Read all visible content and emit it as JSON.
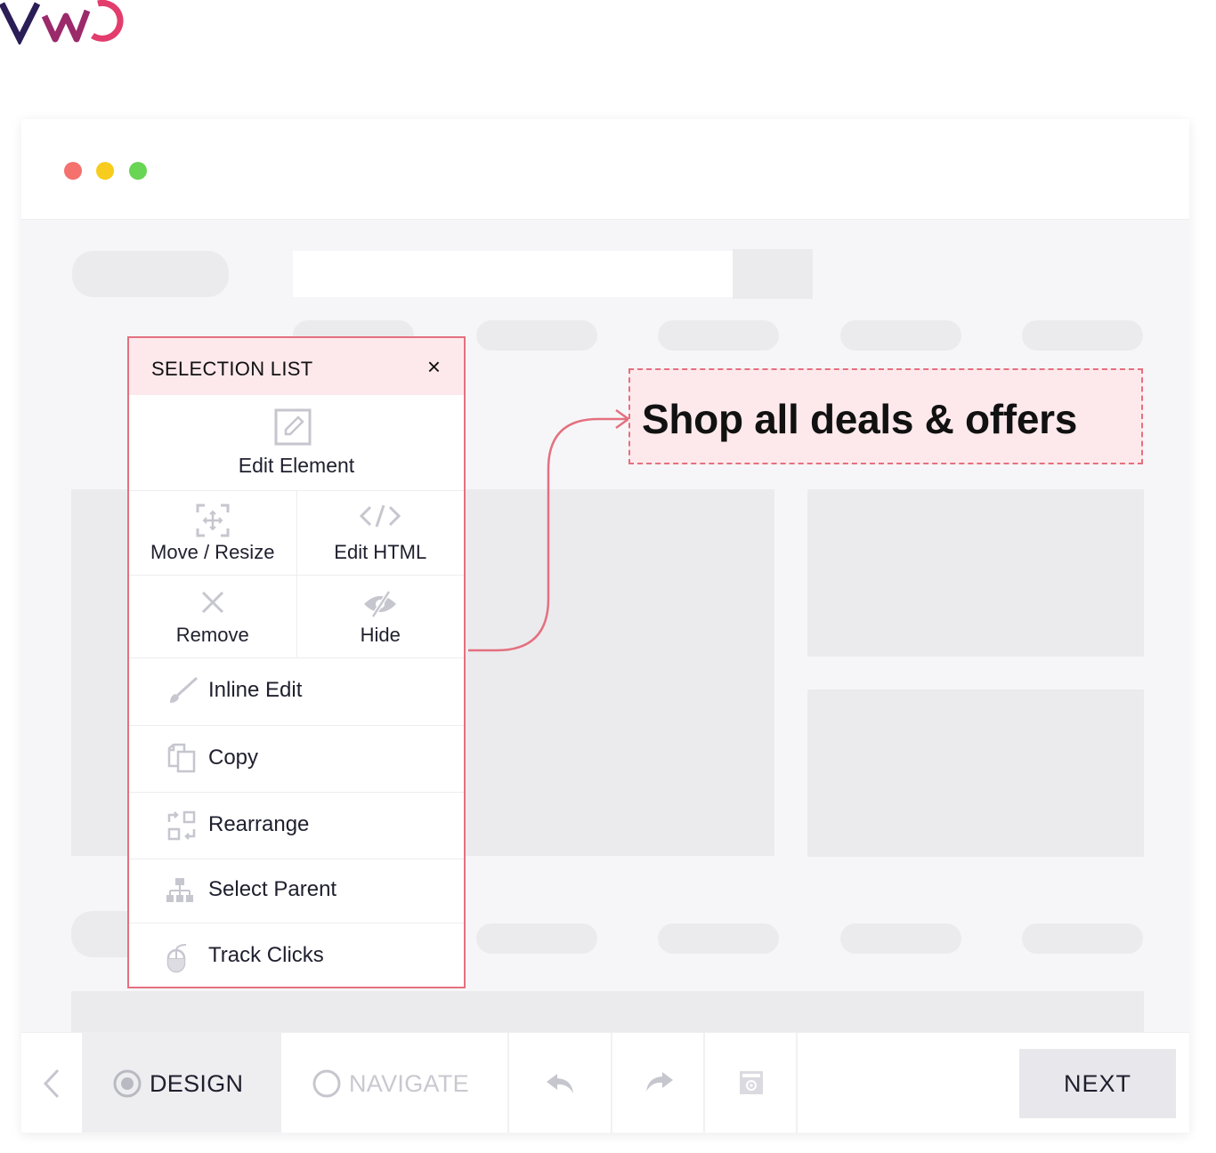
{
  "brand": {
    "logo_icon": "vwo-logo",
    "logo_text": "VWO",
    "accent_color": "#e4707f"
  },
  "browser": {
    "traffic_lights": [
      "#f4716d",
      "#f8cc1d",
      "#68d554"
    ]
  },
  "selection_list": {
    "title": "SELECTION LIST",
    "close_glyph": "×",
    "edit_element": {
      "label": "Edit Element",
      "icon": "edit-icon"
    },
    "grid": [
      {
        "label": "Move / Resize",
        "icon": "move-resize-icon"
      },
      {
        "label": "Edit HTML",
        "icon": "code-icon"
      },
      {
        "label": "Remove",
        "icon": "close-x-icon"
      },
      {
        "label": "Hide",
        "icon": "eye-off-icon"
      }
    ],
    "items": [
      {
        "label": "Inline Edit",
        "icon": "brush-icon"
      },
      {
        "label": "Copy",
        "icon": "copy-icon"
      },
      {
        "label": "Rearrange",
        "icon": "rearrange-icon"
      },
      {
        "label": "Select Parent",
        "icon": "hierarchy-icon"
      },
      {
        "label": "Track Clicks",
        "icon": "mouse-icon"
      }
    ]
  },
  "callout": {
    "text": "Shop all deals & offers"
  },
  "toolbar": {
    "design_label": "DESIGN",
    "navigate_label": "NAVIGATE",
    "next_label": "NEXT"
  }
}
